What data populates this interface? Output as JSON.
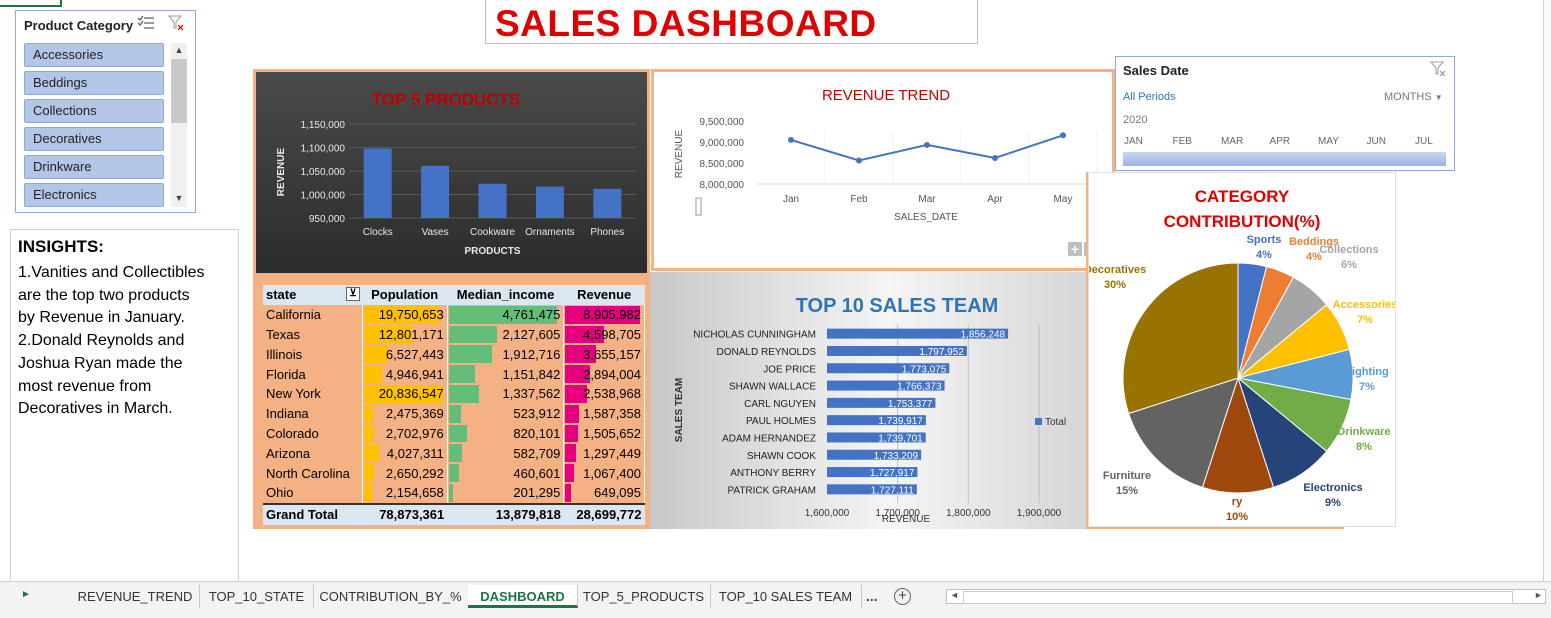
{
  "title": "SALES DASHBOARD",
  "product_slicer": {
    "title": "Product Category",
    "items": [
      "Accessories",
      "Beddings",
      "Collections",
      "Decoratives",
      "Drinkware",
      "Electronics"
    ]
  },
  "insights": {
    "heading": "INSIGHTS:",
    "lines": [
      "1.Vanities and Collectibles",
      "are the top two products",
      "by Revenue in January.",
      "2.Donald Reynolds and",
      "Joshua Ryan made the",
      "most revenue from",
      "Decoratives in March."
    ]
  },
  "date_slicer": {
    "title": "Sales Date",
    "period": "All Periods",
    "level": "MONTHS",
    "year": "2020",
    "months": [
      "JAN",
      "FEB",
      "MAR",
      "APR",
      "MAY",
      "JUN",
      "JUL"
    ]
  },
  "state_table": {
    "headers": [
      "state",
      "Population",
      "Median_income",
      "Revenue"
    ],
    "rows": [
      {
        "state": "California",
        "population": "19,750,653",
        "income": "4,761,475",
        "revenue": "8,905,982",
        "p": 19750653,
        "i": 4761475,
        "r": 8905982
      },
      {
        "state": "Texas",
        "population": "12,801,171",
        "income": "2,127,605",
        "revenue": "4,598,705",
        "p": 12801171,
        "i": 2127605,
        "r": 4598705
      },
      {
        "state": "Illinois",
        "population": "6,527,443",
        "income": "1,912,716",
        "revenue": "3,655,157",
        "p": 6527443,
        "i": 1912716,
        "r": 3655157
      },
      {
        "state": "Florida",
        "population": "4,946,941",
        "income": "1,151,842",
        "revenue": "2,894,004",
        "p": 4946941,
        "i": 1151842,
        "r": 2894004
      },
      {
        "state": "New York",
        "population": "20,836,547",
        "income": "1,337,562",
        "revenue": "2,538,968",
        "p": 20836547,
        "i": 1337562,
        "r": 2538968
      },
      {
        "state": "Indiana",
        "population": "2,475,369",
        "income": "523,912",
        "revenue": "1,587,358",
        "p": 2475369,
        "i": 523912,
        "r": 1587358
      },
      {
        "state": "Colorado",
        "population": "2,702,976",
        "income": "820,101",
        "revenue": "1,505,652",
        "p": 2702976,
        "i": 820101,
        "r": 1505652
      },
      {
        "state": "Arizona",
        "population": "4,027,311",
        "income": "582,709",
        "revenue": "1,297,449",
        "p": 4027311,
        "i": 582709,
        "r": 1297449
      },
      {
        "state": "North Carolina",
        "population": "2,650,292",
        "income": "460,601",
        "revenue": "1,067,400",
        "p": 2650292,
        "i": 460601,
        "r": 1067400
      },
      {
        "state": "Ohio",
        "population": "2,154,658",
        "income": "201,295",
        "revenue": "649,095",
        "p": 2154658,
        "i": 201295,
        "r": 649095
      }
    ],
    "total": {
      "label": "Grand Total",
      "population": "78,873,361",
      "income": "13,879,818",
      "revenue": "28,699,772"
    },
    "colors": {
      "population": "#ffc000",
      "income": "#63be7b",
      "revenue": "#e6007e"
    }
  },
  "sheet_tabs": [
    "REVENUE_TREND",
    "TOP_10_STATE",
    "CONTRIBUTION_BY_%",
    "DASHBOARD",
    "TOP_5_PRODUCTS",
    "TOP_10 SALES TEAM"
  ],
  "active_tab": "DASHBOARD",
  "tab_more": "...",
  "chart_data": [
    {
      "type": "bar",
      "title": "TOP 5 PRODUCTS",
      "xlabel": "PRODUCTS",
      "ylabel": "REVENUE",
      "categories": [
        "Clocks",
        "Vases",
        "Cookware",
        "Ornaments",
        "Phones"
      ],
      "values": [
        1098000,
        1061000,
        1023000,
        1017000,
        1012000
      ],
      "ylim": [
        950000,
        1150000
      ],
      "yticks": [
        "1,150,000",
        "1,100,000",
        "1,050,000",
        "1,000,000",
        "950,000"
      ],
      "color": "#4472c4"
    },
    {
      "type": "line",
      "title": "REVENUE TREND",
      "xlabel": "SALES_DATE",
      "ylabel": "REVENUE",
      "categories": [
        "Jan",
        "Feb",
        "Mar",
        "Apr",
        "May"
      ],
      "values": [
        9050000,
        8560000,
        8930000,
        8620000,
        9160000
      ],
      "ylim": [
        8000000,
        9500000
      ],
      "yticks": [
        "9,500,000",
        "9,000,000",
        "8,500,000",
        "8,000,000"
      ],
      "color": "#4472c4",
      "zoom_buttons": [
        "+",
        "−"
      ]
    },
    {
      "type": "bar",
      "title": "TOP 10 SALES TEAM",
      "xlabel": "REVENUE",
      "ylabel": "SALES TEAM",
      "legend": "Total",
      "categories": [
        "NICHOLAS CUNNINGHAM",
        "DONALD REYNOLDS",
        "JOE PRICE",
        "SHAWN WALLACE",
        "CARL NGUYEN",
        "PAUL HOLMES",
        "ADAM HERNANDEZ",
        "SHAWN COOK",
        "ANTHONY BERRY",
        "PATRICK GRAHAM"
      ],
      "values": [
        1856248,
        1797952,
        1773075,
        1766373,
        1753377,
        1739917,
        1739701,
        1733209,
        1727917,
        1727111
      ],
      "labels": [
        "1,856,248",
        "1,797,952",
        "1,773,075",
        "1,766,373",
        "1,753,377",
        "1,739,917",
        "1,739,701",
        "1,733,209",
        "1,727,917",
        "1,727,111"
      ],
      "xlim": [
        1600000,
        1900000
      ],
      "xticks": [
        "1,600,000",
        "1,700,000",
        "1,800,000",
        "1,900,000"
      ],
      "color": "#4472c4"
    },
    {
      "type": "pie",
      "title": "CATEGORY CONTRIBUTION(%)",
      "slices": [
        {
          "label": "Sports",
          "pct": 4,
          "display": "4%",
          "color": "#4472c4"
        },
        {
          "label": "Beddings",
          "pct": 4,
          "display": "4%",
          "color": "#ed7d31"
        },
        {
          "label": "Collections",
          "pct": 6,
          "display": "6%",
          "color": "#a5a5a5"
        },
        {
          "label": "Accessories",
          "pct": 7,
          "display": "7%",
          "color": "#ffc000"
        },
        {
          "label": "Lighting",
          "pct": 7,
          "display": "7%",
          "color": "#5b9bd5"
        },
        {
          "label": "Drinkware",
          "pct": 8,
          "display": "8%",
          "color": "#70ad47"
        },
        {
          "label": "Electronics",
          "pct": 9,
          "display": "9%",
          "color": "#264478"
        },
        {
          "label": "ry",
          "pct": 10,
          "display": "10%",
          "color": "#9e480e"
        },
        {
          "label": "Furniture",
          "pct": 15,
          "display": "15%",
          "color": "#636363"
        },
        {
          "label": "Decoratives",
          "pct": 30,
          "display": "30%",
          "color": "#997300"
        }
      ]
    }
  ]
}
